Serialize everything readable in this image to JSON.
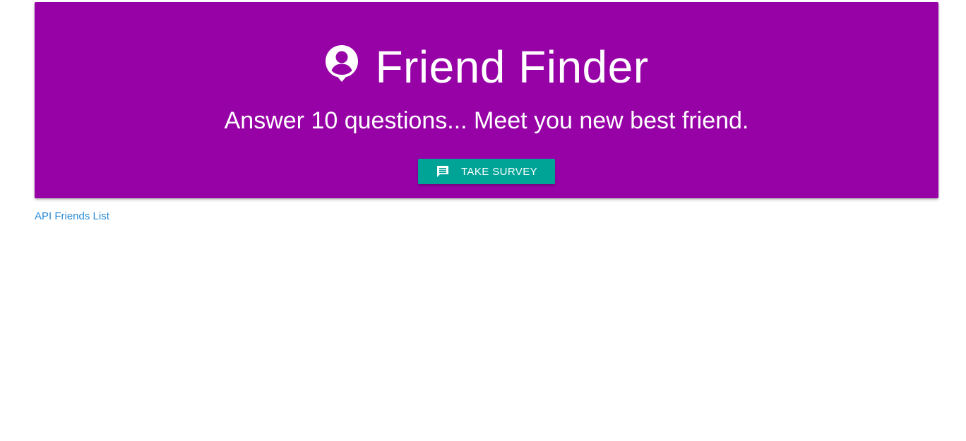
{
  "hero": {
    "title": "Friend Finder",
    "title_icon": "person-pin-icon",
    "subtitle": "Answer 10 questions... Meet you new best friend.",
    "background_color": "#9702a7"
  },
  "survey_button": {
    "label": "TAKE SURVEY",
    "icon": "chat-bubble-icon",
    "color": "#00a497"
  },
  "links": {
    "api_friends_list": "API Friends List",
    "link_color": "#2b8bd6"
  }
}
